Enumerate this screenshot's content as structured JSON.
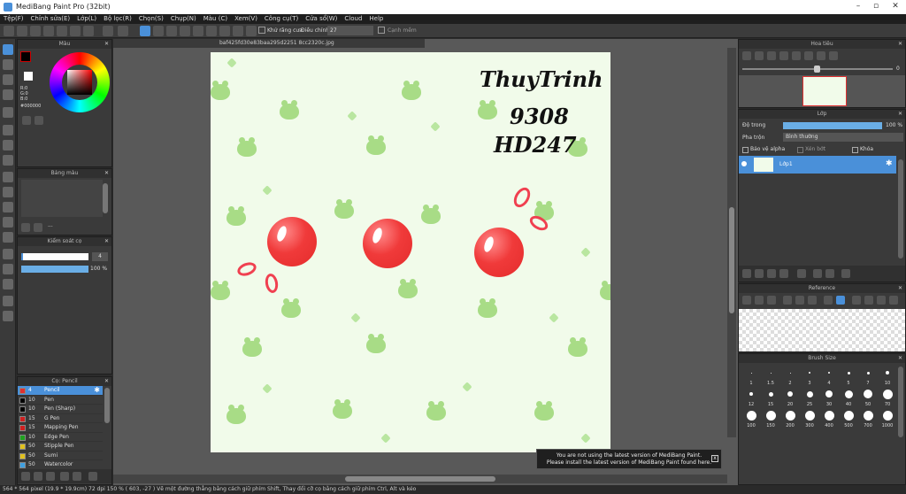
{
  "window": {
    "title": "MediBang Paint Pro (32bit)"
  },
  "menu": [
    "Tệp(F)",
    "Chỉnh sửa(E)",
    "Lớp(L)",
    "Bộ lọc(R)",
    "Chọn(S)",
    "Chụp(N)",
    "Màu (C)",
    "Xem(V)",
    "Công cụ(T)",
    "Cửa sổ(W)",
    "Cloud",
    "Help"
  ],
  "toolbar": {
    "antialias_label": "Khử răng cưa",
    "adjust_label": "Điều chỉnh",
    "adjust_value": "27",
    "fringe_label": "Cạnh mềm"
  },
  "document": {
    "tab_name": "baf425fd30e83baa295d2251 8cc2320c.jpg"
  },
  "color_panel": {
    "title": "Màu",
    "r": "R:0",
    "g": "G:0",
    "b": "B:0",
    "hex": "#000000"
  },
  "palette_panel": {
    "title": "Bảng màu"
  },
  "brush_control": {
    "title": "Kiểm soát cọ",
    "size": "4",
    "opacity": "100 %"
  },
  "brush_panel": {
    "title": "Cọ: Pencil",
    "items": [
      {
        "size": "4",
        "name": "Pencil",
        "color": "#e03030",
        "selected": true
      },
      {
        "size": "10",
        "name": "Pen",
        "color": "#000000"
      },
      {
        "size": "10",
        "name": "Pen (Sharp)",
        "color": "#000000"
      },
      {
        "size": "15",
        "name": "G Pen",
        "color": "#d02020"
      },
      {
        "size": "15",
        "name": "Mapping Pen",
        "color": "#d02020"
      },
      {
        "size": "10",
        "name": "Edge Pen",
        "color": "#20a020"
      },
      {
        "size": "50",
        "name": "Stipple Pen",
        "color": "#e0c020"
      },
      {
        "size": "50",
        "name": "Sumi",
        "color": "#e0c020"
      },
      {
        "size": "50",
        "name": "Watercolor",
        "color": "#40a0e0"
      }
    ]
  },
  "canvas": {
    "handwriting": [
      "ThuyTrinh",
      "9308",
      "HD247"
    ],
    "bg_color": "#f1fbea",
    "ball_color": "#f03a3a",
    "frog_color": "#a8dc86"
  },
  "navigator": {
    "title": "Hoa tiêu",
    "zoom": "0"
  },
  "layer_panel": {
    "title": "Lớp",
    "opacity_label": "Độ trong",
    "opacity_value": "100 %",
    "opacity_fill": 1.0,
    "blend_label": "Pha trộn",
    "blend_value": "Bình thường",
    "protect_label": "Bảo vệ alpha",
    "clip_label": "Xén bớt",
    "lock_label": "Khóa",
    "layer_name": "Lớp1"
  },
  "reference_panel": {
    "title": "Reference"
  },
  "brush_size_panel": {
    "title": "Brush Size",
    "sizes": [
      [
        "1",
        "1.5",
        "2",
        "3",
        "4",
        "5",
        "7",
        "10"
      ],
      [
        "12",
        "15",
        "20",
        "25",
        "30",
        "40",
        "50",
        "70"
      ],
      [
        "100",
        "150",
        "200",
        "300",
        "400",
        "500",
        "700",
        "1000"
      ]
    ]
  },
  "notice": {
    "line1": "You are not using the latest version of MediBang Paint.",
    "line2": "Please install the latest version of MediBang Paint found here.",
    "close": "x"
  },
  "status": {
    "text": "564 * 564 pixel   (19.9 * 19.9cm)   72 dpi   150 %   ( 603, -27 )   Vẽ một đường thẳng bằng cách giữ phím Shift, Thay đổi cỡ cọ bằng cách giữ phím Ctrl, Alt và kéo"
  }
}
